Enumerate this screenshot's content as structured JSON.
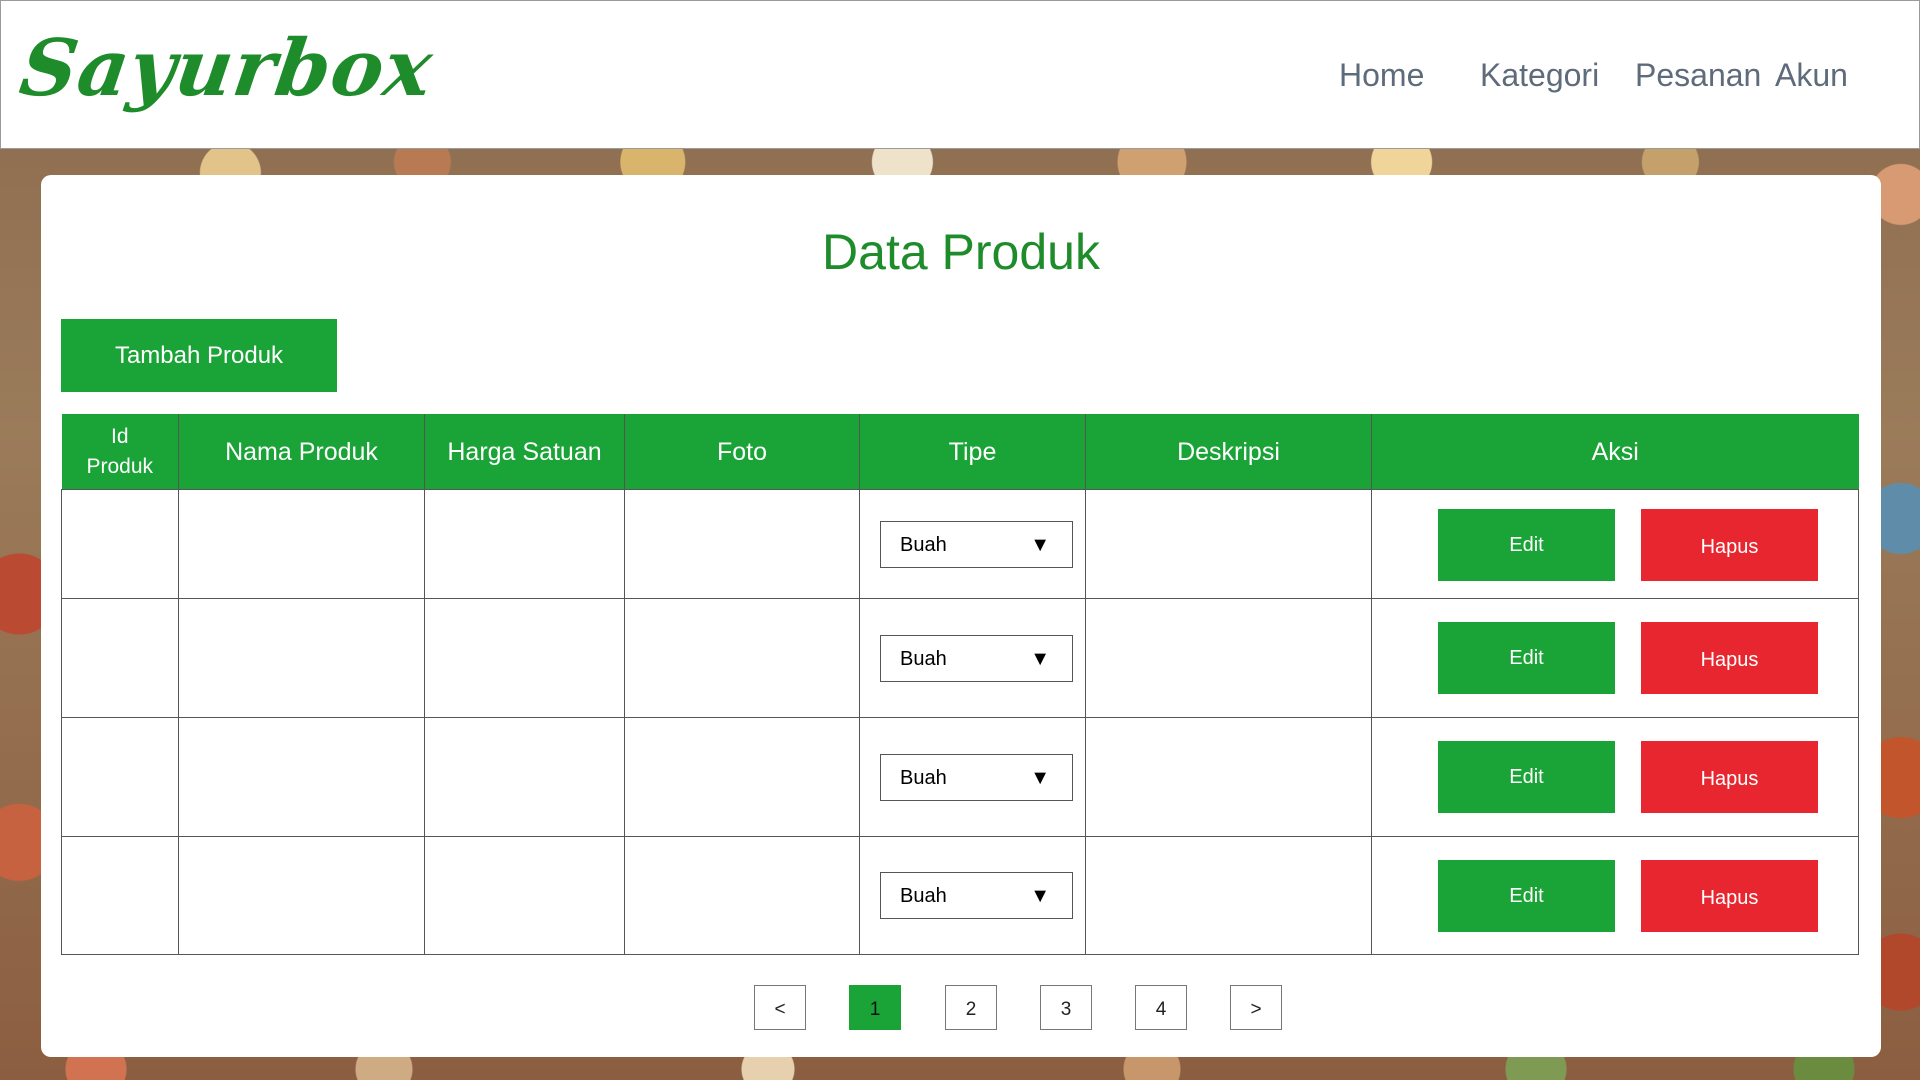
{
  "header": {
    "logo": "Sayurbox",
    "nav": [
      "Home",
      "Kategori",
      "Pesanan",
      "Akun"
    ]
  },
  "main": {
    "title": "Data Produk",
    "add_button": "Tambah Produk",
    "table": {
      "headers": [
        "Id Produk",
        "Nama Produk",
        "Harga Satuan",
        "Foto",
        "Tipe",
        "Deskripsi",
        "Aksi"
      ],
      "rows": [
        {
          "type": "Buah",
          "edit": "Edit",
          "delete": "Hapus"
        },
        {
          "type": "Buah",
          "edit": "Edit",
          "delete": "Hapus"
        },
        {
          "type": "Buah",
          "edit": "Edit",
          "delete": "Hapus"
        },
        {
          "type": "Buah",
          "edit": "Edit",
          "delete": "Hapus"
        }
      ]
    },
    "pagination": {
      "prev": "<",
      "pages": [
        "1",
        "2",
        "3",
        "4"
      ],
      "next": ">",
      "current": "1"
    }
  },
  "colors": {
    "brand_green": "#1f8c2b",
    "button_green": "#1aa336",
    "danger_red": "#e8262f",
    "nav_text": "#5e6b7a"
  },
  "icons": {
    "select_arrow": "triangle-down-icon"
  }
}
